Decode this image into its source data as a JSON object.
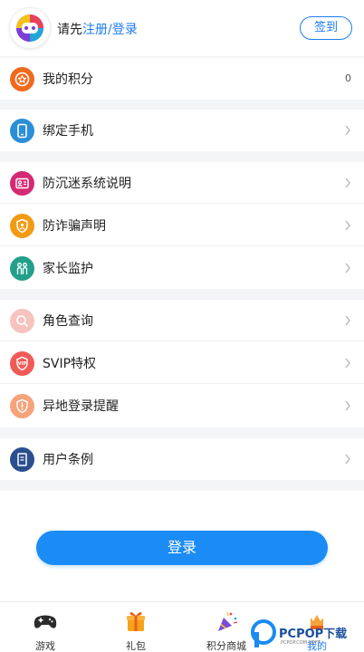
{
  "header": {
    "prompt_prefix": "请先",
    "prompt_link": "注册/登录",
    "signin_label": "签到"
  },
  "menu": {
    "points": {
      "label": "我的积分",
      "value": "0",
      "icon": "star-icon",
      "color": "#ef6a1d"
    },
    "bind_phone": {
      "label": "绑定手机",
      "icon": "phone-icon",
      "color": "#2a8fd6"
    },
    "anti_addiction": {
      "label": "防沉迷系统说明",
      "icon": "id-card-icon",
      "color": "#d42a74"
    },
    "anti_fraud": {
      "label": "防诈骗声明",
      "icon": "shield-icon",
      "color": "#f39a15"
    },
    "parental": {
      "label": "家长监护",
      "icon": "family-icon",
      "color": "#22a08a"
    },
    "role_query": {
      "label": "角色查询",
      "icon": "search-icon",
      "color": "#f7b8b4"
    },
    "svip": {
      "label": "SVIP特权",
      "icon": "vip-icon",
      "color": "#f05b57"
    },
    "remote_login": {
      "label": "异地登录提醒",
      "icon": "alert-shield-icon",
      "color": "#f5a37b"
    },
    "terms": {
      "label": "用户条例",
      "icon": "document-icon",
      "color": "#2b4f8e"
    }
  },
  "login_button": "登录",
  "tabs": [
    {
      "label": "游戏",
      "icon": "gamepad-icon"
    },
    {
      "label": "礼包",
      "icon": "gift-icon"
    },
    {
      "label": "积分商城",
      "icon": "party-popper-icon"
    },
    {
      "label": "我的",
      "icon": "profile-icon"
    }
  ],
  "watermark": {
    "brand": "PCPOP下载",
    "sub": "PCPOP.COM SOFT"
  }
}
